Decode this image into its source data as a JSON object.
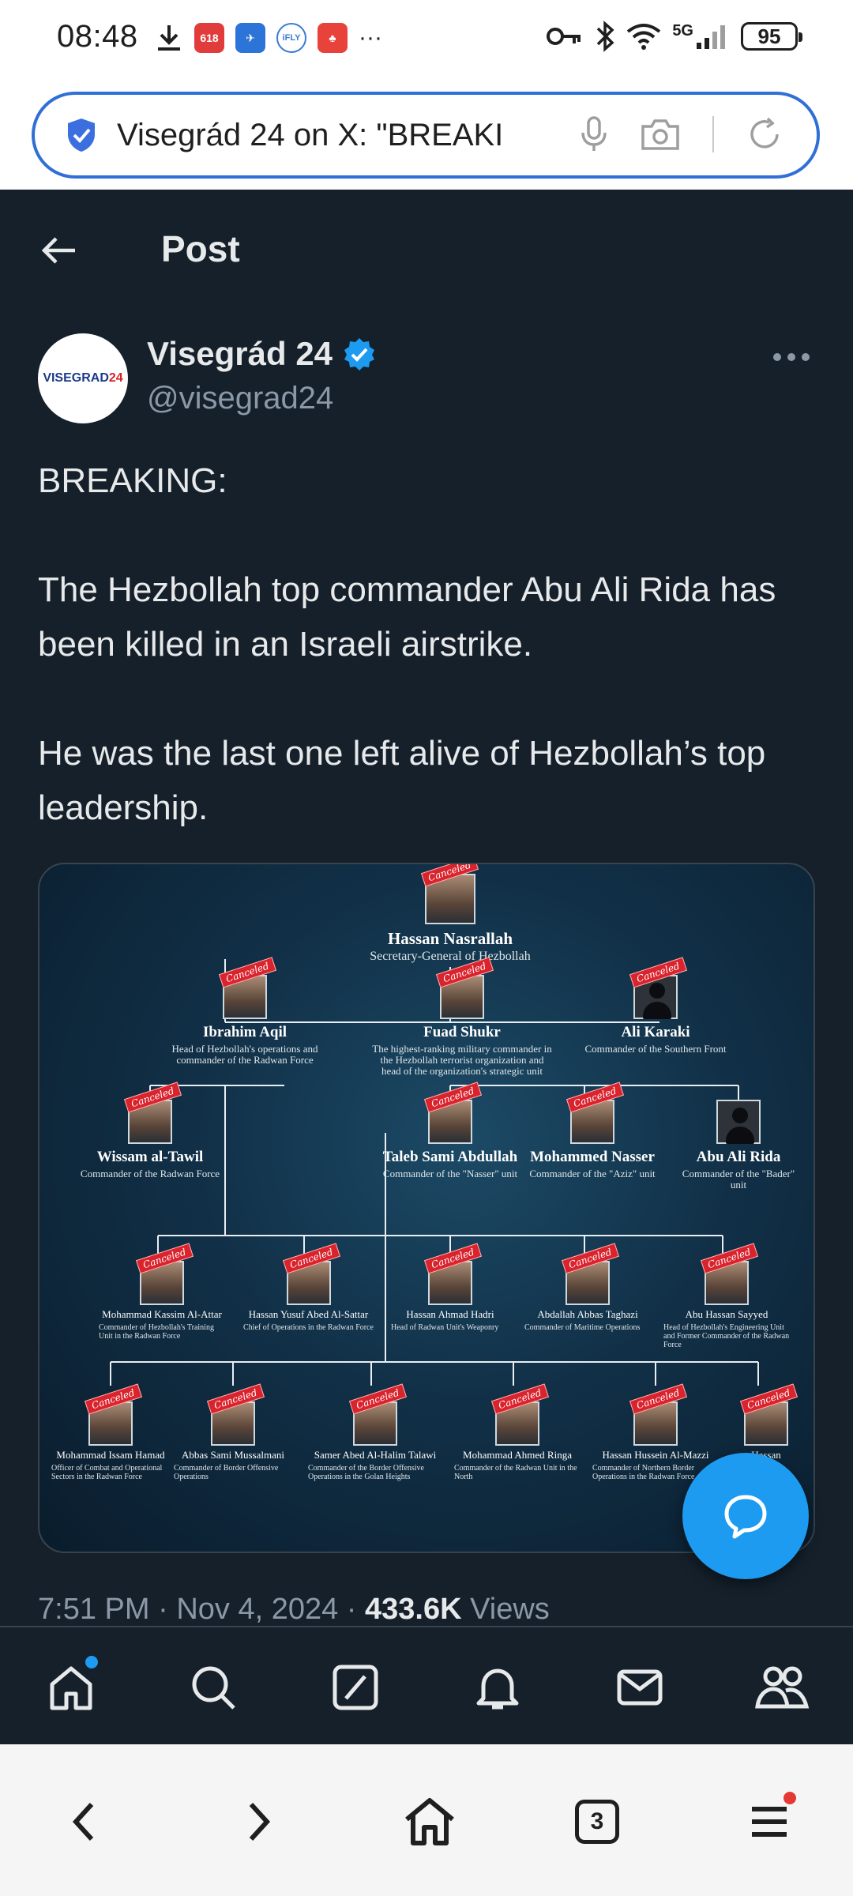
{
  "status_bar": {
    "time": "08:48",
    "network": "5G",
    "battery": "95",
    "app_icons": [
      "download-icon",
      "app-618-icon",
      "bird-app-icon",
      "ifly-icon",
      "game-app-icon",
      "more-dots"
    ]
  },
  "browser": {
    "url_text": "Visegrád 24 on X: \"BREAKI",
    "tab_count": "3"
  },
  "header": {
    "title": "Post"
  },
  "author": {
    "name": "Visegrád 24",
    "handle": "@visegrad24",
    "avatar_text_a": "VISEGRAD",
    "avatar_text_b": "24"
  },
  "post": {
    "line1": "BREAKING:",
    "para2": "The Hezbollah top commander Abu Ali Rida has been killed in an Israeli airstrike.",
    "para3": "He was the last one left alive of Hezbollah’s top leadership."
  },
  "media": {
    "stamp_text": "Canceled",
    "top": {
      "name": "Hassan Nasrallah",
      "role": "Secretary-General of Hezbollah"
    },
    "tier2": [
      {
        "name": "Ibrahim Aqil",
        "role": "Head of Hezbollah's operations and commander of the Radwan Force"
      },
      {
        "name": "Fuad Shukr",
        "role": "The highest-ranking military commander in the Hezbollah terrorist organization and head of the organization's strategic unit"
      },
      {
        "name": "Ali Karaki",
        "role": "Commander of the Southern Front"
      }
    ],
    "tier3": [
      {
        "name": "Wissam al-Tawil",
        "role": "Commander of the Radwan Force"
      },
      {
        "name": "Taleb Sami Abdullah",
        "role": "Commander of the \"Nasser\" unit"
      },
      {
        "name": "Mohammed Nasser",
        "role": "Commander of the \"Aziz\" unit"
      },
      {
        "name": "Abu Ali Rida",
        "role": "Commander of the \"Bader\" unit"
      }
    ],
    "tier4": [
      {
        "name": "Mohammad Kassim Al-Attar",
        "role": "Commander of Hezbollah's Training Unit in the Radwan Force"
      },
      {
        "name": "Hassan Yusuf Abed Al-Sattar",
        "role": "Chief of Operations in the Radwan Force"
      },
      {
        "name": "Hassan Ahmad Hadri",
        "role": "Head of Radwan Unit's Weaponry"
      },
      {
        "name": "Abdallah Abbas Taghazi",
        "role": "Commander of Maritime Operations"
      },
      {
        "name": "Abu Hassan Sayyed",
        "role": "Head of Hezbollah's Engineering Unit and Former Commander of the Radwan Force"
      }
    ],
    "tier5": [
      {
        "name": "Mohammad Issam Hamad",
        "role": "Officer of Combat and Operational Sectors in the Radwan Force"
      },
      {
        "name": "Abbas Sami Mussalmani",
        "role": "Commander of Border Offensive Operations"
      },
      {
        "name": "Samer Abed Al-Halim Talawi",
        "role": "Commander of the Border Offensive Operations in the Golan Heights"
      },
      {
        "name": "Mohammad Ahmed Ringa",
        "role": "Commander of the Radwan Unit in the North"
      },
      {
        "name": "Hassan Hussein Al-Mazzi",
        "role": "Commander of Northern Border Operations in the Radwan Force"
      },
      {
        "name": "Hassan",
        "role": ""
      }
    ]
  },
  "meta": {
    "time": "7:51 PM",
    "separator": "·",
    "date": "Nov 4, 2024",
    "views_count": "433.6K",
    "views_label": "Views"
  },
  "colors": {
    "background": "#15202b",
    "accent": "#1d9bf0",
    "secondary_text": "#8b98a5",
    "stamp": "#d9232d"
  }
}
